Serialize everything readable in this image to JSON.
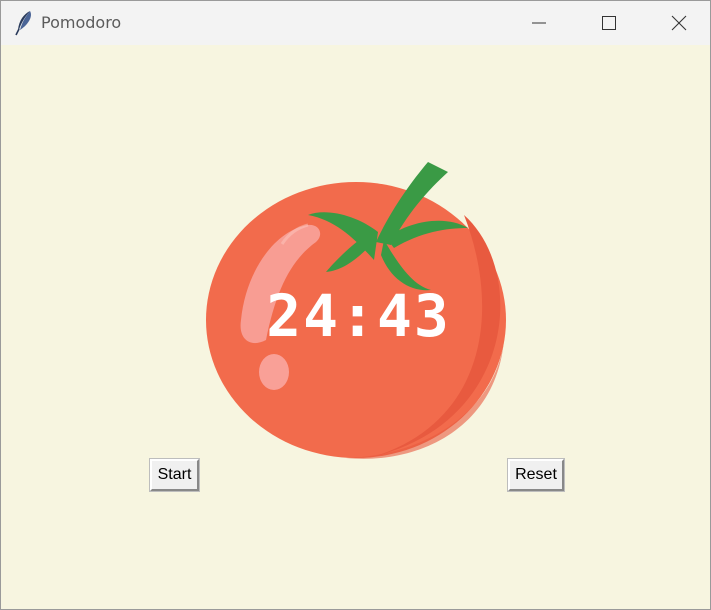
{
  "window": {
    "title": "Pomodoro",
    "app_icon": "feather-icon",
    "controls": {
      "minimize_icon": "minimize-icon",
      "maximize_icon": "maximize-icon",
      "close_icon": "close-icon"
    }
  },
  "timer": {
    "display": "24:43"
  },
  "buttons": {
    "start_label": "Start",
    "reset_label": "Reset"
  },
  "colors": {
    "background": "#f7f5e0",
    "tomato": "#f26b4c",
    "leaf": "#3a9a45",
    "timer_text": "#ffffff"
  }
}
